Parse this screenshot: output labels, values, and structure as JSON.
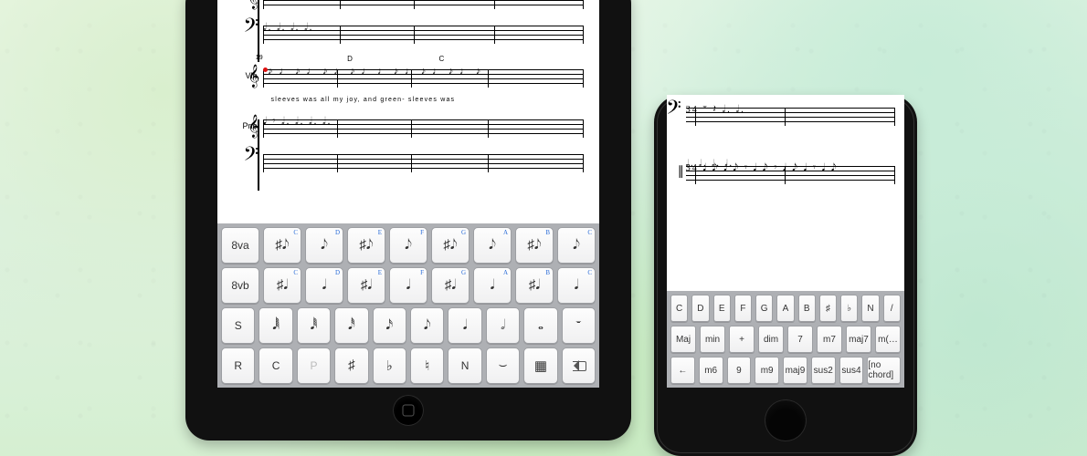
{
  "ipad": {
    "instrument_piano": "Pno.",
    "instrument_violin": "Vln.",
    "system2_measure_num": "19",
    "chords": [
      "D",
      "C"
    ],
    "lyrics_line": "sleeves    was         all        my        joy,        and        green-  sleeves            was",
    "keyboard": {
      "row1_left": "8va",
      "row2_left": "8vb",
      "note_labels": [
        "C",
        "D",
        "E",
        "F",
        "G",
        "A",
        "B",
        "C"
      ],
      "row3": [
        "S",
        "𝅘𝅥𝅲",
        "𝅘𝅥𝅱",
        "𝅘𝅥𝅰",
        "𝅘𝅥𝅯",
        "𝅘𝅥𝅮",
        "𝅘𝅥",
        "𝅗𝅥",
        "𝅝",
        "𝄻"
      ],
      "row4": [
        "R",
        "C",
        "P",
        "♯",
        "♭",
        "♮",
        "N",
        "⌣",
        "▦",
        "⌫"
      ]
    }
  },
  "iphone": {
    "keyboard": {
      "row1": [
        "C",
        "D",
        "E",
        "F",
        "G",
        "A",
        "B",
        "♯",
        "♭",
        "N",
        "/"
      ],
      "row2": [
        "Maj",
        "min",
        "+",
        "dim",
        "7",
        "m7",
        "maj7",
        "m(…"
      ],
      "row3": [
        "←",
        "m6",
        "9",
        "m9",
        "maj9",
        "sus2",
        "sus4",
        "[no chord]"
      ]
    }
  }
}
